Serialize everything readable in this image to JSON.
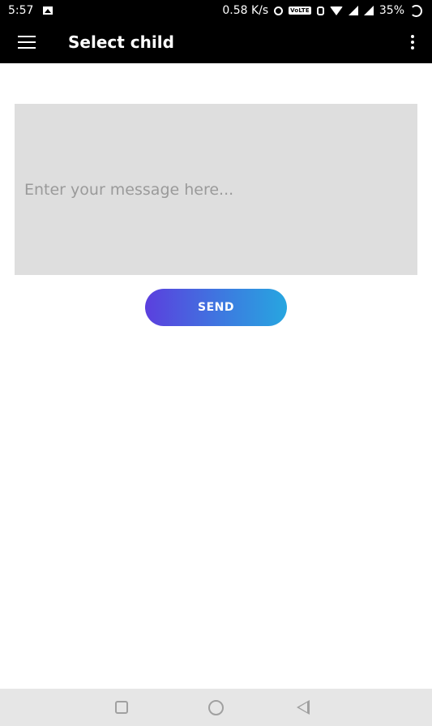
{
  "status_bar": {
    "time": "5:57",
    "network_speed": "0.58 K/s",
    "volte_label": "VoLTE",
    "battery": "35%",
    "icons": [
      "image-icon",
      "alarm-icon",
      "vibrate-icon",
      "wifi-icon",
      "signal-icon",
      "signal-icon",
      "battery-icon"
    ]
  },
  "app_bar": {
    "title": "Select child",
    "menu_icon": "hamburger-menu-icon",
    "overflow_icon": "more-vert-icon"
  },
  "message": {
    "value": "",
    "placeholder": "Enter your message here..."
  },
  "send_button": {
    "label": "SEND",
    "gradient_start": "#5b3fde",
    "gradient_end": "#27a6e0"
  },
  "nav_bar": {
    "icons": [
      "recents-icon",
      "home-icon",
      "back-icon"
    ]
  },
  "colors": {
    "app_bar_bg": "#000000",
    "input_bg": "#dedede",
    "nav_bar_bg": "#e6e6e6"
  }
}
